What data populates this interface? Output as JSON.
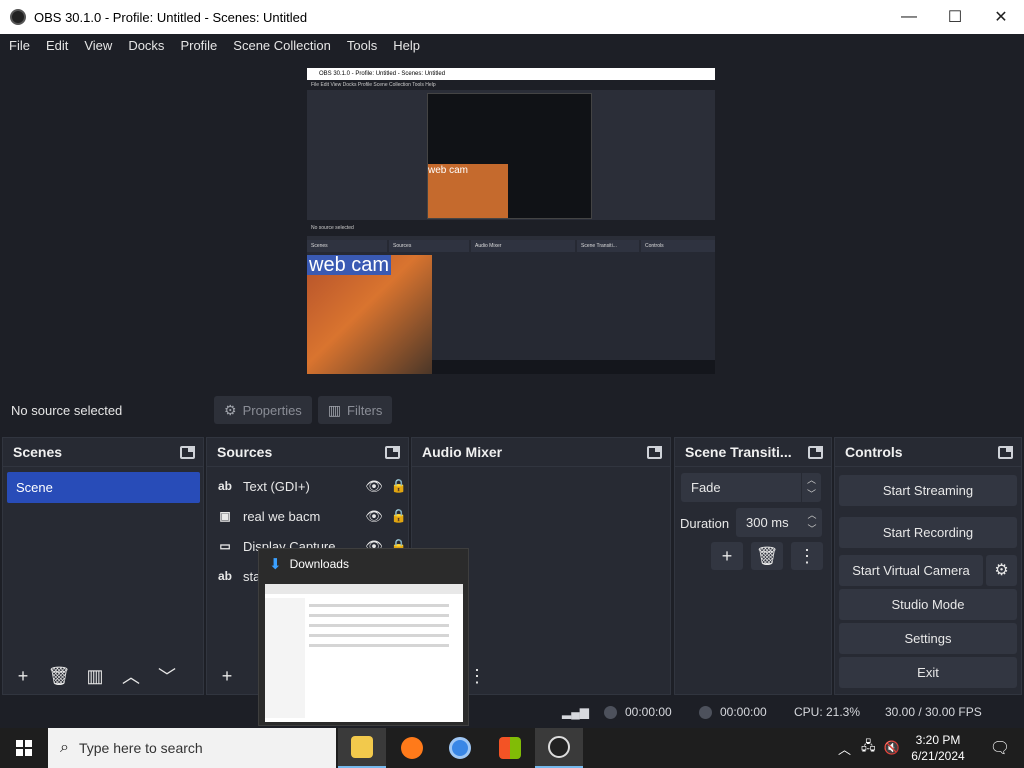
{
  "window": {
    "title": "OBS 30.1.0 - Profile: Untitled - Scenes: Untitled",
    "minimize": "—",
    "maximize": "☐",
    "close": "✕"
  },
  "menu": [
    "File",
    "Edit",
    "View",
    "Docks",
    "Profile",
    "Scene Collection",
    "Tools",
    "Help"
  ],
  "preview": {
    "nested_title": "OBS 30.1.0 - Profile: Untitled - Scenes: Untitled",
    "nested_menu": "File  Edit  View  Docks  Profile  Scene Collection  Tools  Help",
    "nested_status": "No source selected",
    "nested_panels": [
      "Scenes",
      "Sources",
      "Audio Mixer",
      "Scene Transiti...",
      "Controls"
    ],
    "webcam_label": "web cam",
    "nested_webcam_label": "web cam"
  },
  "toolbar": {
    "no_source": "No source selected",
    "properties": "Properties",
    "filters": "Filters"
  },
  "scenes": {
    "title": "Scenes",
    "items": [
      "Scene"
    ]
  },
  "sources": {
    "title": "Sources",
    "items": [
      {
        "icon": "ab",
        "name": "Text (GDI+)"
      },
      {
        "icon": "▣",
        "name": "real we bacm"
      },
      {
        "icon": "▭",
        "name": "Display Capture"
      },
      {
        "icon": "ab",
        "name": "sta"
      }
    ]
  },
  "audio_mixer": {
    "title": "Audio Mixer"
  },
  "transitions": {
    "title": "Scene Transiti...",
    "selected": "Fade",
    "duration_label": "Duration",
    "duration_value": "300 ms"
  },
  "controls": {
    "title": "Controls",
    "start_streaming": "Start Streaming",
    "start_recording": "Start Recording",
    "start_virtual_camera": "Start Virtual Camera",
    "studio_mode": "Studio Mode",
    "settings": "Settings",
    "exit": "Exit"
  },
  "status": {
    "stream_time": "00:00:00",
    "record_time": "00:00:00",
    "cpu": "CPU: 21.3%",
    "fps": "30.00 / 30.00 FPS"
  },
  "downloads_popup": {
    "title": "Downloads"
  },
  "taskbar": {
    "search_placeholder": "Type here to search",
    "time": "3:20 PM",
    "date": "6/21/2024"
  }
}
